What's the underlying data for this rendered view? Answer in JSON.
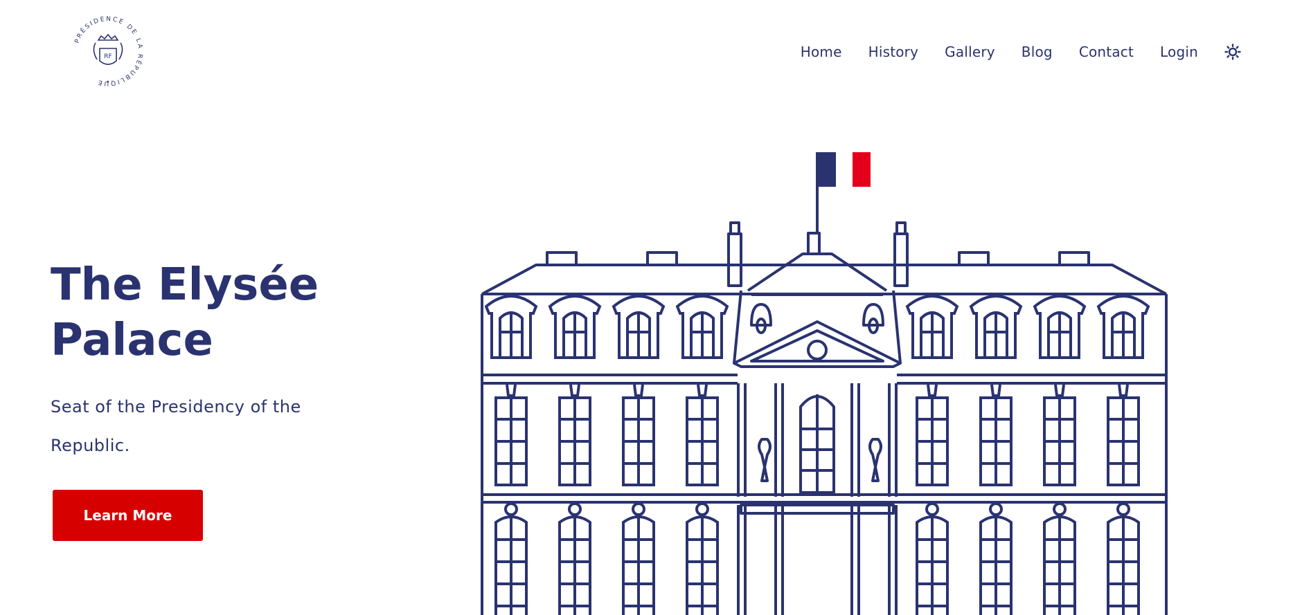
{
  "logo": {
    "text": "PRÉSIDENCE DE LA RÉPUBLIQUE",
    "monogram": "RF"
  },
  "nav": {
    "items": [
      {
        "label": "Home"
      },
      {
        "label": "History"
      },
      {
        "label": "Gallery"
      },
      {
        "label": "Blog"
      },
      {
        "label": "Contact"
      },
      {
        "label": "Login"
      }
    ],
    "theme_icon": "sun-icon"
  },
  "hero": {
    "title": "The Elysée Palace",
    "subtitle": "Seat of the Presidency of the Republic.",
    "cta_label": "Learn More"
  },
  "colors": {
    "navy": "#2a3370",
    "red": "#d70000",
    "flag_blue": "#2a3370",
    "flag_red": "#e2001a",
    "background": "#ffffff"
  }
}
